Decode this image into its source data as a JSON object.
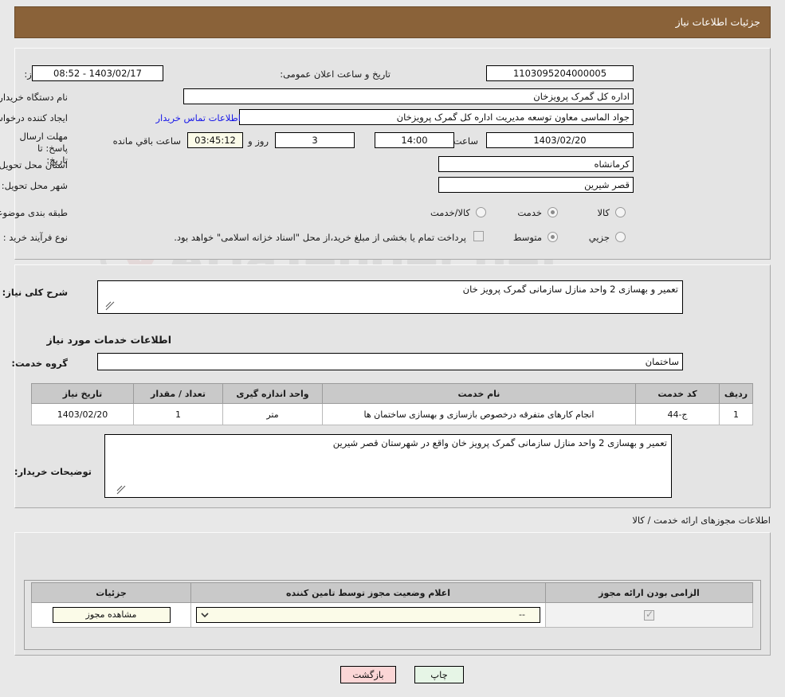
{
  "window": {
    "title": "جزئیات اطلاعات نیاز",
    "title_bar_color": "#8a6239"
  },
  "watermark": {
    "text": "AriaTender.net"
  },
  "top_form": {
    "need_number_label": "شماره نیاز:",
    "need_number_value": "1103095204000005",
    "announce_datetime_label": "تاریخ و ساعت اعلان عمومی:",
    "announce_datetime_value": "1403/02/17 - 08:52",
    "buyer_org_label": "نام دستگاه خریدار:",
    "buyer_org_value": "اداره کل گمرک پرویزخان",
    "creator_label": "ایجاد کننده درخواست:",
    "creator_value": "جواد الماسی معاون توسعه مدیریت اداره کل گمرک پرویزخان",
    "contact_link": "اطلاعات تماس خریدار",
    "deadline_label": "مهلت ارسال پاسخ: تا تاریخ:",
    "deadline_date": "1403/02/20",
    "hour_label": "ساعت",
    "deadline_time": "14:00",
    "days_remaining": "3",
    "days_and_label": "روز و",
    "time_remaining": "03:45:12",
    "remaining_suffix_label": "ساعت باقي مانده",
    "province_label": "استان محل تحویل:",
    "province_value": "کرمانشاه",
    "city_label": "شهر محل تحویل:",
    "city_value": "قصر شیرین",
    "category_label": "طبقه بندی موضوعی:",
    "category_options": [
      "کالا",
      "خدمت",
      "کالا/خدمت"
    ],
    "category_selected": "خدمت",
    "process_label": "نوع فرآیند خرید :",
    "process_options": [
      "جزیي",
      "متوسط"
    ],
    "process_selected": "متوسط",
    "treasury_note": "پرداخت تمام یا بخشی از مبلغ خرید،از محل \"اسناد خزانه اسلامی\" خواهد بود."
  },
  "middle": {
    "general_desc_label": "شرح کلی نیاز:",
    "general_desc_value": "تعمیر و بهسازی 2 واحد منازل سازمانی گمرک پرویز خان",
    "services_info_heading": "اطلاعات خدمات مورد نیاز",
    "service_group_label": "گروه خدمت:",
    "service_group_value": "ساختمان",
    "table": {
      "headers": [
        "ردیف",
        "کد خدمت",
        "نام خدمت",
        "واحد اندازه گیری",
        "تعداد / مقدار",
        "تاریخ نیاز"
      ],
      "rows": [
        {
          "row": "1",
          "service_code": "ج-44",
          "service_name": "انجام کارهای متفرقه درخصوص بازسازی و بهسازی ساختمان ها",
          "unit": "متر",
          "quantity": "1",
          "need_date": "1403/02/20"
        }
      ]
    },
    "buyer_notes_label": "توضیحات خریدار:",
    "buyer_notes_value": "تعمیر و بهسازی 2 واحد منازل سازمانی گمرک پرویز خان واقع در شهرستان قصر شیرین"
  },
  "licenses": {
    "heading": "اطلاعات مجوزهای ارائه خدمت / کالا",
    "headers": [
      "الزامی بودن ارائه مجوز",
      "اعلام وضعیت مجوز توسط تامین کننده",
      "جزئیات"
    ],
    "rows": [
      {
        "required_checked": true,
        "status_value": "--",
        "details_button": "مشاهده مجوز"
      }
    ]
  },
  "footer": {
    "print_label": "چاپ",
    "back_label": "بازگشت"
  }
}
